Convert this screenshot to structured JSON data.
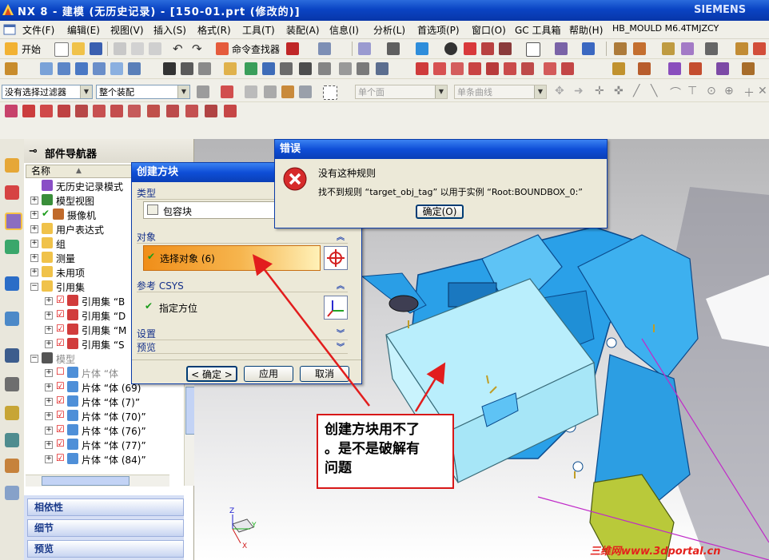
{
  "window": {
    "title": "NX 8 - 建模 (无历史记录) - [150-01.prt (修改的)]",
    "brand": "SIEMENS"
  },
  "menu": [
    "文件(F)",
    "编辑(E)",
    "视图(V)",
    "插入(S)",
    "格式(R)",
    "工具(T)",
    "装配(A)",
    "信息(I)",
    "分析(L)",
    "首选项(P)",
    "窗口(O)",
    "GC 工具箱",
    "帮助(H)",
    "HB_MOULD M6.4",
    "TMJZCY"
  ],
  "toolbar": {
    "start_label": "开始",
    "command_finder_label": "命令查找器"
  },
  "selection_bar": {
    "filter_value": "没有选择过滤器",
    "scope_value": "整个装配",
    "face_rule_value": "单个面",
    "curve_rule_value": "单条曲线"
  },
  "navigator": {
    "title": "部件导航器",
    "column_name": "名称",
    "items": [
      {
        "label": "无历史记录模式",
        "level": 1
      },
      {
        "label": "模型视图",
        "level": 1
      },
      {
        "label": "摄像机",
        "level": 1
      },
      {
        "label": "用户表达式",
        "level": 1
      },
      {
        "label": "组",
        "level": 1
      },
      {
        "label": "测量",
        "level": 1
      },
      {
        "label": "未用项",
        "level": 1
      },
      {
        "label": "引用集",
        "level": 1
      },
      {
        "label": "引用集 “B",
        "level": 2
      },
      {
        "label": "引用集 “D",
        "level": 2
      },
      {
        "label": "引用集 “M",
        "level": 2
      },
      {
        "label": "引用集 “S",
        "level": 2
      },
      {
        "label": "模型",
        "level": 1
      },
      {
        "label": "片体 “体",
        "level": 2
      },
      {
        "label": "片体 “体 (69)",
        "level": 2
      },
      {
        "label": "片体 “体 (7)”",
        "level": 2
      },
      {
        "label": "片体 “体 (70)”",
        "level": 2
      },
      {
        "label": "片体 “体 (76)”",
        "level": 2
      },
      {
        "label": "片体 “体 (77)”",
        "level": 2
      },
      {
        "label": "片体 “体 (84)”",
        "level": 2
      }
    ],
    "bottom_panels": [
      "相依性",
      "细节",
      "预览"
    ]
  },
  "block_dialog": {
    "title": "创建方块",
    "type_group": "类型",
    "type_value": "包容块",
    "object_group": "对象",
    "select_object": "选择对象 (6)",
    "csys_group": "参考 CSYS",
    "orientation": "指定方位",
    "settings_group": "设置",
    "preview_group": "预览",
    "ok": "< 确定 >",
    "apply": "应用",
    "cancel": "取消"
  },
  "error_dialog": {
    "title": "错误",
    "line1": "没有这种规则",
    "line2": "找不到规则 “target_obj_tag” 以用于实例 “Root:BOUNDBOX_0:”",
    "ok": "确定(O)"
  },
  "annotation": {
    "text": "创建方块用不了。是不是破解有问题",
    "line1": "创建方块用不了",
    "line2": "。是不是破解有",
    "line3": "问题"
  },
  "watermark": "三维网www.3dportal.cn",
  "colors": {
    "titlebar": "#0a44c4",
    "accent_orange": "#f39a1e",
    "error_red": "#d81818",
    "model_blue": "#2a9ee6"
  }
}
